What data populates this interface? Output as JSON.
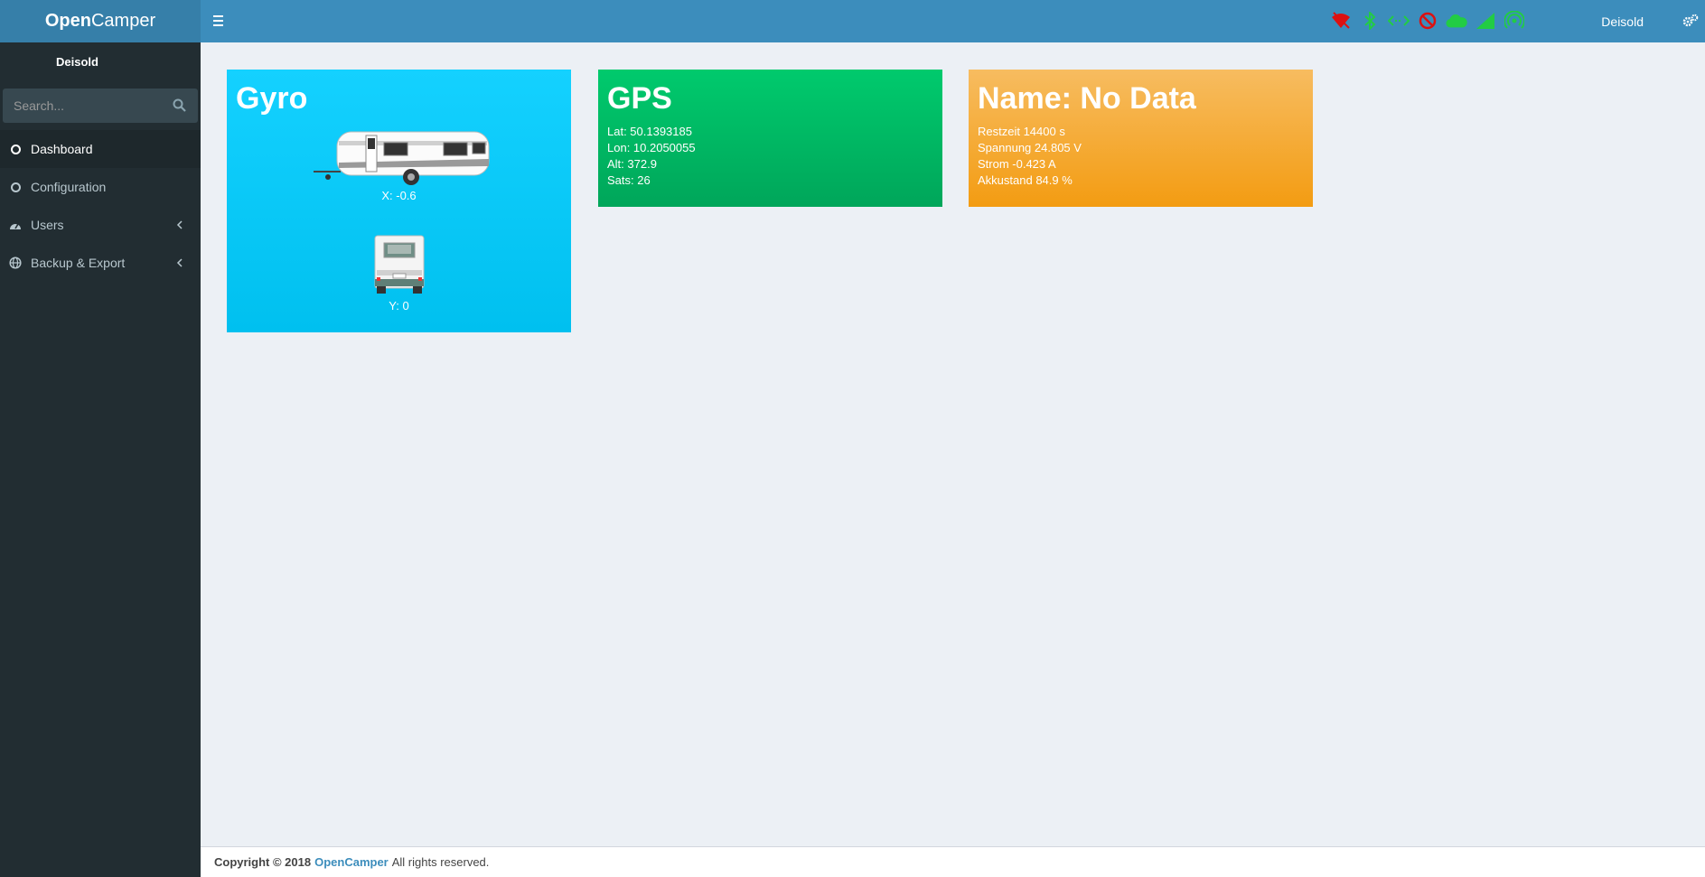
{
  "app": {
    "logo_bold": "Open",
    "logo_rest": "Camper"
  },
  "navbar": {
    "user_name": "Deisold",
    "status_icons": [
      {
        "name": "wifi-off-icon",
        "color": "#dd1111"
      },
      {
        "name": "bluetooth-icon",
        "color": "#22cc44"
      },
      {
        "name": "link-icon",
        "color": "#22cc44"
      },
      {
        "name": "no-entry-icon",
        "color": "#dd1111"
      },
      {
        "name": "cloud-icon",
        "color": "#22cc44"
      },
      {
        "name": "signal-icon",
        "color": "#22cc44"
      },
      {
        "name": "gps-antenna-icon",
        "color": "#22cc44"
      }
    ]
  },
  "sidebar": {
    "user_name": "Deisold",
    "search_placeholder": "Search...",
    "menu": [
      {
        "label": "Dashboard",
        "icon": "circle-icon",
        "active": true
      },
      {
        "label": "Configuration",
        "icon": "circle-icon",
        "active": false
      },
      {
        "label": "Users",
        "icon": "dashboard-gauge-icon",
        "active": false
      },
      {
        "label": "Backup & Export",
        "icon": "globe-icon",
        "active": false
      }
    ]
  },
  "gyro": {
    "title": "Gyro",
    "x_text": "X: -0.6",
    "y_text": "Y: 0"
  },
  "gps": {
    "title": "GPS",
    "lat": "Lat: 50.1393185",
    "lon": "Lon: 10.2050055",
    "alt": "Alt: 372.9",
    "sats": "Sats: 26"
  },
  "battery": {
    "title": "Name: No Data",
    "restzeit": "Restzeit 14400 s",
    "spannung": "Spannung 24.805 V",
    "strom": "Strom -0.423 A",
    "akkustand": "Akkustand 84.9 %"
  },
  "footer": {
    "copyright": "Copyright © 2018",
    "link": "OpenCamper",
    "rights": "All rights reserved."
  },
  "colors": {
    "header": "#3c8dbc",
    "logo_bg": "#367fa9",
    "sidebar": "#222d32",
    "aqua": "#00c0ef",
    "green": "#00a65a",
    "orange": "#f39c12"
  }
}
